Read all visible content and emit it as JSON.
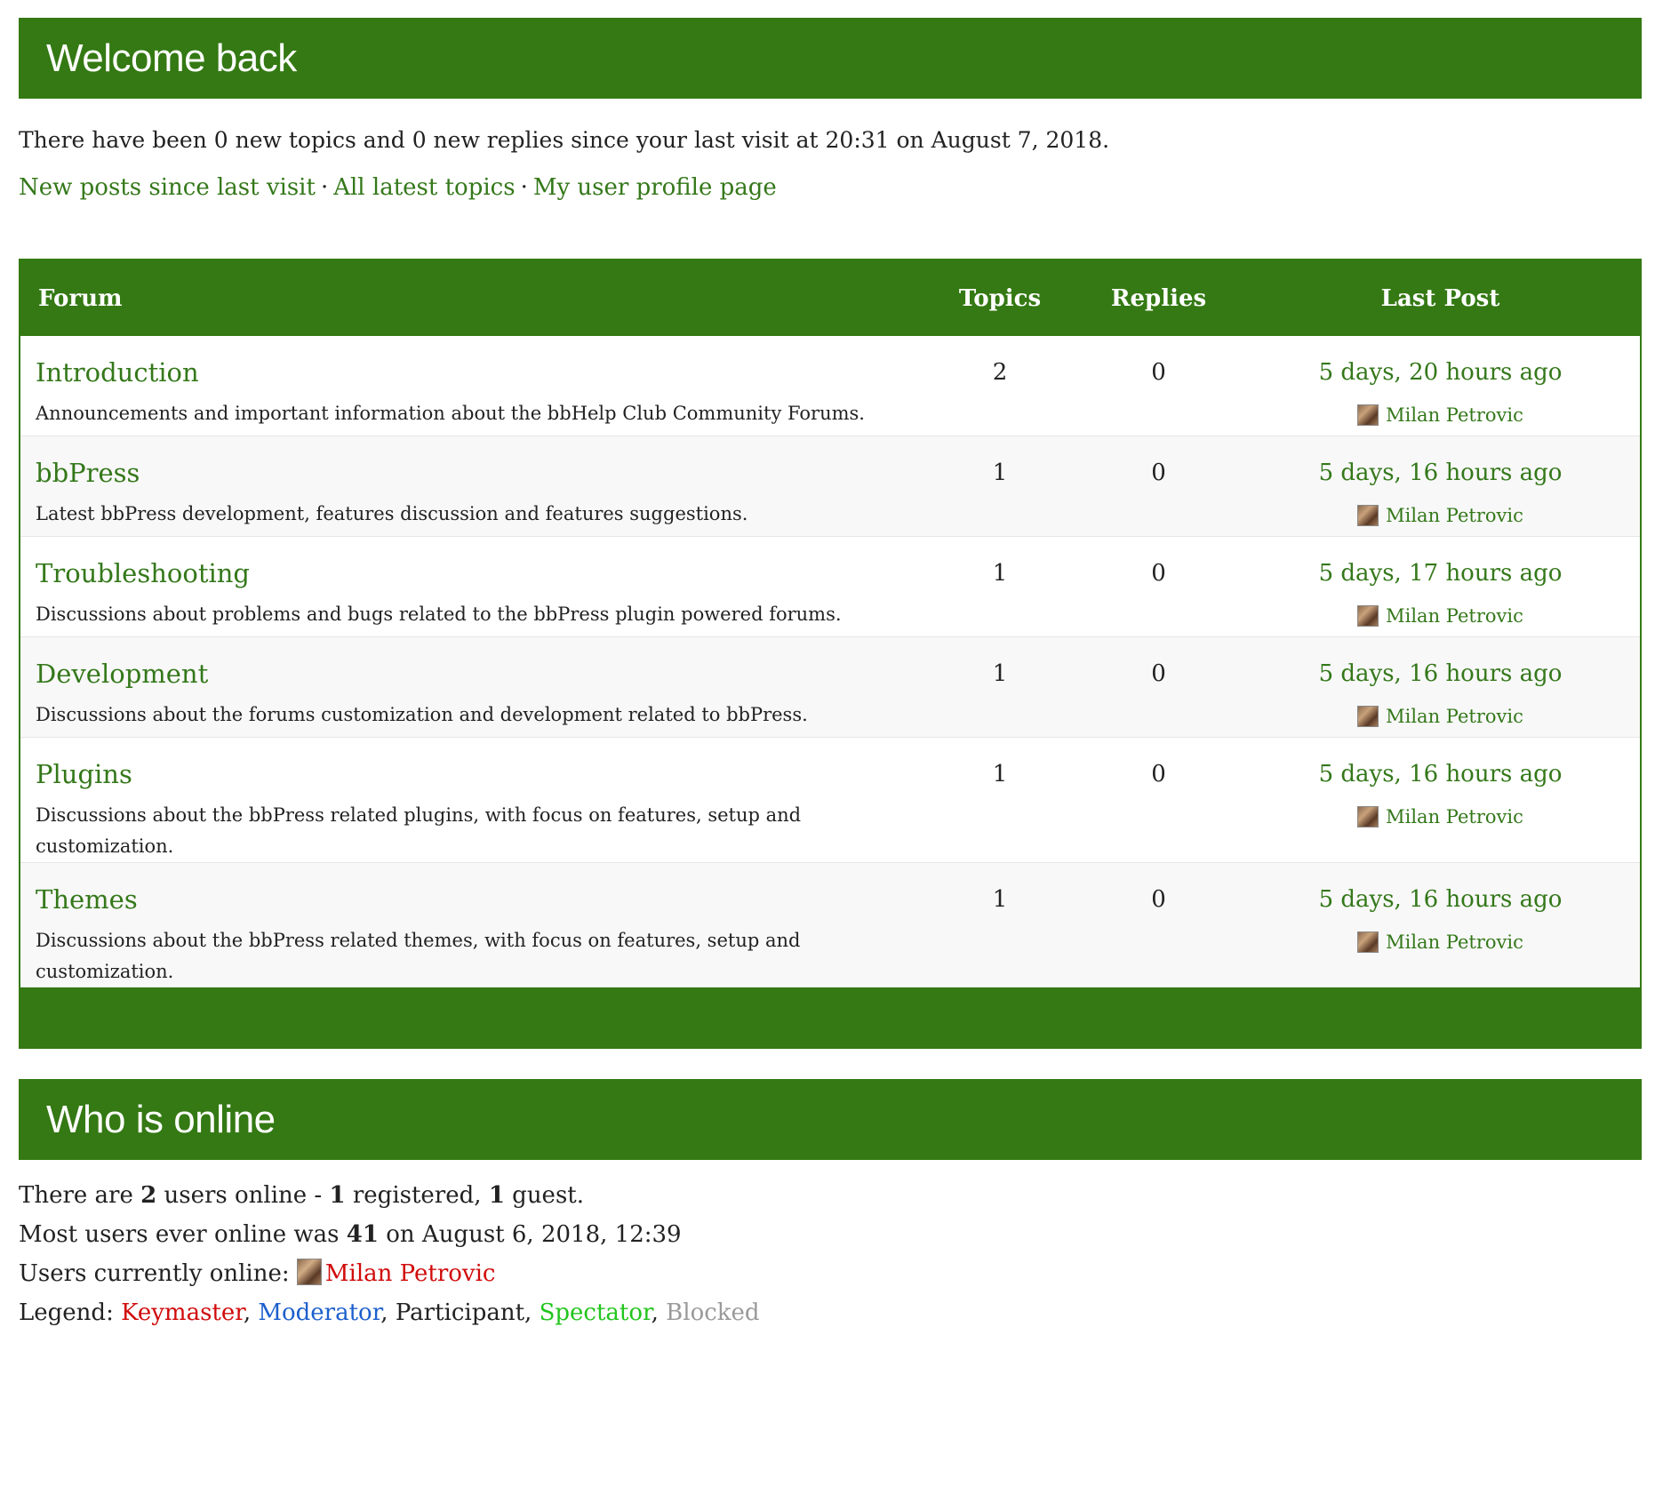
{
  "welcome": {
    "title": "Welcome back",
    "text": "There have been 0 new topics and 0 new replies since your last visit at 20:31 on August 7, 2018.",
    "links": [
      "New posts since last visit",
      "All latest topics",
      "My user profile page"
    ],
    "separator": "·"
  },
  "forum_table": {
    "headers": {
      "forum": "Forum",
      "topics": "Topics",
      "replies": "Replies",
      "last_post": "Last Post"
    },
    "rows": [
      {
        "title": "Introduction",
        "description": "Announcements and important information about the bbHelp Club Community Forums.",
        "topics": "2",
        "replies": "0",
        "freshness": "5 days, 20 hours ago",
        "author": "Milan Petrovic"
      },
      {
        "title": "bbPress",
        "description": "Latest bbPress development, features discussion and features suggestions.",
        "topics": "1",
        "replies": "0",
        "freshness": "5 days, 16 hours ago",
        "author": "Milan Petrovic"
      },
      {
        "title": "Troubleshooting",
        "description": "Discussions about problems and bugs related to the bbPress plugin powered forums.",
        "topics": "1",
        "replies": "0",
        "freshness": "5 days, 17 hours ago",
        "author": "Milan Petrovic"
      },
      {
        "title": "Development",
        "description": "Discussions about the forums customization and development related to bbPress.",
        "topics": "1",
        "replies": "0",
        "freshness": "5 days, 16 hours ago",
        "author": "Milan Petrovic"
      },
      {
        "title": "Plugins",
        "description": "Discussions about the bbPress related plugins, with focus on features, setup and customization.",
        "topics": "1",
        "replies": "0",
        "freshness": "5 days, 16 hours ago",
        "author": "Milan Petrovic"
      },
      {
        "title": "Themes",
        "description": "Discussions about the bbPress related themes, with focus on features, setup and customization.",
        "topics": "1",
        "replies": "0",
        "freshness": "5 days, 16 hours ago",
        "author": "Milan Petrovic"
      }
    ]
  },
  "online": {
    "title": "Who is online",
    "line1": {
      "prefix": "There are ",
      "total": "2",
      "mid1": " users online - ",
      "registered": "1",
      "mid2": " registered, ",
      "guests": "1",
      "suffix": " guest."
    },
    "line2": {
      "prefix": "Most users ever online was ",
      "max": "41",
      "suffix": " on August 6, 2018, 12:39"
    },
    "line3": {
      "prefix": "Users currently online: ",
      "user": "Milan Petrovic"
    },
    "legend": {
      "prefix": "Legend: ",
      "keymaster": "Keymaster",
      "moderator": "Moderator",
      "participant": "Participant",
      "spectator": "Spectator",
      "blocked": "Blocked",
      "comma": ", "
    }
  },
  "colors": {
    "brand_green": "#347913",
    "link_green": "#34781a",
    "keymaster": "#d10b0b",
    "moderator": "#1c5fcc",
    "spectator": "#22c41d",
    "blocked": "#9a9a9a"
  }
}
